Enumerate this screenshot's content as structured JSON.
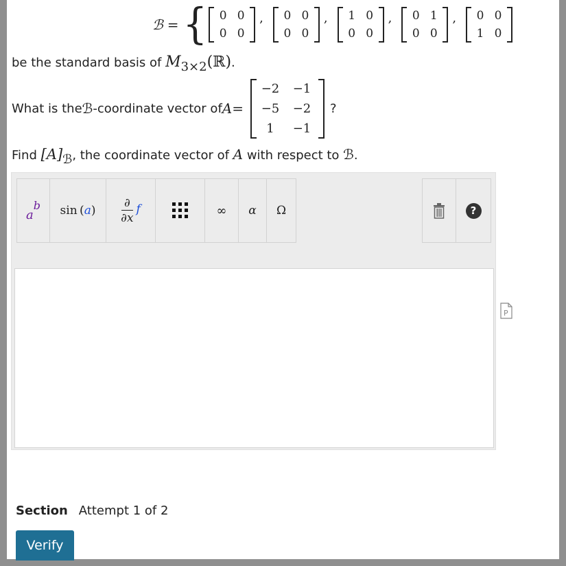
{
  "basis": {
    "symbol": "ℬ",
    "equals": "=",
    "open_brace": "{",
    "matrices": [
      {
        "r1": [
          "0",
          "0"
        ],
        "r2": [
          "0",
          "0"
        ]
      },
      {
        "r1": [
          "0",
          "0"
        ],
        "r2": [
          "0",
          "0"
        ]
      },
      {
        "r1": [
          "1",
          "0"
        ],
        "r2": [
          "0",
          "0"
        ]
      },
      {
        "r1": [
          "0",
          "1"
        ],
        "r2": [
          "0",
          "0"
        ]
      },
      {
        "r1": [
          "0",
          "0"
        ],
        "r2": [
          "1",
          "0"
        ]
      }
    ],
    "separator": ","
  },
  "line1": {
    "text": "be the standard basis of ",
    "space_symbol": "M",
    "space_subscript": "3×2",
    "space_field": "(ℝ)",
    "period": "."
  },
  "question": {
    "prefix": "What is the ",
    "bsym": "ℬ",
    "middle": "-coordinate vector of ",
    "avar": "A",
    "equals": " = ",
    "matrix": [
      [
        "−2",
        "−1"
      ],
      [
        "−5",
        "−2"
      ],
      [
        "1",
        "−1"
      ]
    ],
    "suffix": "?"
  },
  "find": {
    "prefix": "Find ",
    "bracket": "[A]",
    "sub": "ℬ",
    "middle": ", the coordinate vector of ",
    "avar": "A",
    "middle2": " with respect to ",
    "bsym": "ℬ",
    "period": "."
  },
  "toolbar": {
    "power": {
      "base": "a",
      "exp": "b"
    },
    "sin": {
      "fn": "sin",
      "arg": "a"
    },
    "deriv": {
      "num": "∂",
      "den": "∂x",
      "f": "f"
    },
    "infinity": "∞",
    "alpha": "α",
    "omega": "Ω",
    "help": "?"
  },
  "section": {
    "label": "Section",
    "attempt": "Attempt 1 of 2"
  },
  "verify_label": "Verify",
  "colors": {
    "verify_bg": "#1f6f94",
    "exp_purple": "#6a1b9a",
    "func_blue": "#1e4fd8",
    "frame": "#8f8f8f"
  }
}
